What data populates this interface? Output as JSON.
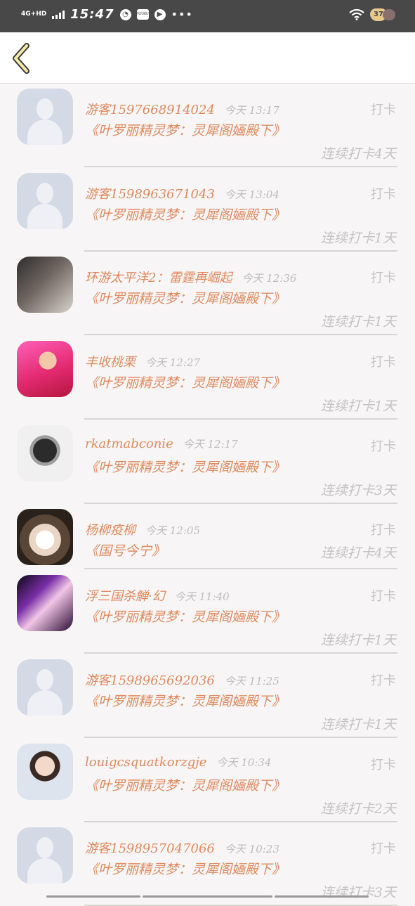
{
  "status_bar": {
    "network": "4G+HD",
    "time": "15:47",
    "app_icon_1": "clock-icon",
    "app_icon_2_label": "YOUKU",
    "app_icon_3": "play-icon",
    "more": "•••",
    "battery_level": "37"
  },
  "header": {
    "back_icon": "chevron-left-icon"
  },
  "items": [
    {
      "name": "游客1597668914024",
      "time": "今天 13:17",
      "action": "打卡",
      "book": "《叶罗丽精灵梦：灵犀阁婳殿下》",
      "streak": "连续打卡4天",
      "avatar": "default"
    },
    {
      "name": "游客1598963671043",
      "time": "今天 13:04",
      "action": "打卡",
      "book": "《叶罗丽精灵梦：灵犀阁婳殿下》",
      "streak": "连续打卡1天",
      "avatar": "default"
    },
    {
      "name": "环游太平洋2：雷霆再崛起",
      "time": "今天 12:36",
      "action": "打卡",
      "book": "《叶罗丽精灵梦：灵犀阁婳殿下》",
      "streak": "连续打卡1天",
      "avatar": "photo-girl-dark"
    },
    {
      "name": "丰收桃栗",
      "time": "今天 12:27",
      "action": "打卡",
      "book": "《叶罗丽精灵梦：灵犀阁婳殿下》",
      "streak": "连续打卡1天",
      "avatar": "photo-doll-pink"
    },
    {
      "name": "rkatmabconie",
      "time": "今天 12:17",
      "action": "打卡",
      "book": "《叶罗丽精灵梦：灵犀阁婳殿下》",
      "streak": "连续打卡3天",
      "avatar": "photo-robot"
    },
    {
      "name": "杨柳疫柳",
      "time": "今天 12:05",
      "action": "打卡",
      "book": "《国号今宁》",
      "streak": "连续打卡4天",
      "avatar": "photo-cat"
    },
    {
      "name": "浮三国杀觯·幻",
      "time": "今天 11:40",
      "action": "打卡",
      "book": "《叶罗丽精灵梦：灵犀阁婳殿下》",
      "streak": "连续打卡1天",
      "avatar": "photo-girl-purple"
    },
    {
      "name": "游客1598965692036",
      "time": "今天 11:25",
      "action": "打卡",
      "book": "《叶罗丽精灵梦：灵犀阁婳殿下》",
      "streak": "连续打卡1天",
      "avatar": "default"
    },
    {
      "name": "louigcsquatkorzgje",
      "time": "今天 10:34",
      "action": "打卡",
      "book": "《叶罗丽精灵梦：灵犀阁婳殿下》",
      "streak": "连续打卡2天",
      "avatar": "photo-boy"
    },
    {
      "name": "游客1598957047066",
      "time": "今天 10:23",
      "action": "打卡",
      "book": "《叶罗丽精灵梦：灵犀阁婳殿下》",
      "streak": "连续打卡3天",
      "avatar": "default"
    }
  ]
}
